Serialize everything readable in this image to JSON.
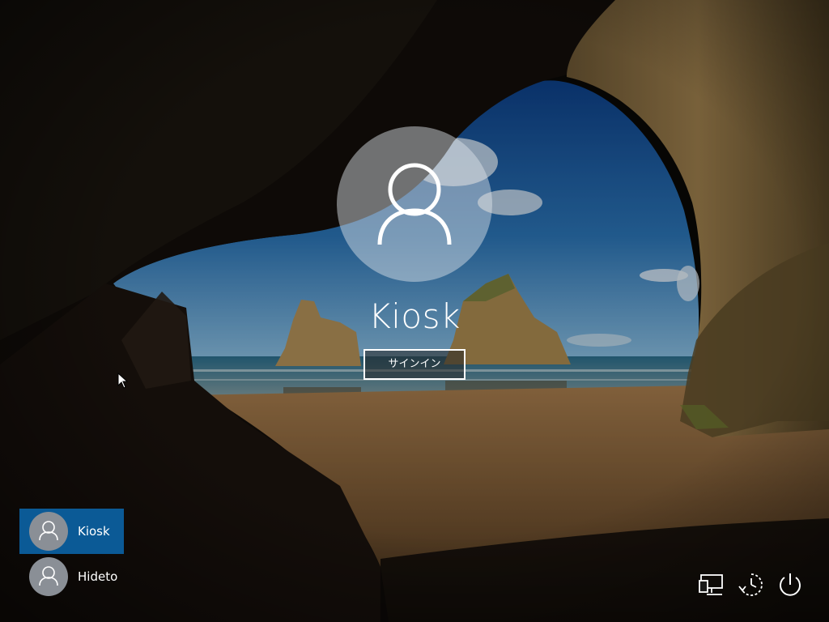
{
  "lock_screen": {
    "background": "cave-beach-wallpaper",
    "avatar_icon": "user-icon",
    "username": "Kiosk",
    "signin_label": "サインイン"
  },
  "users": [
    {
      "name": "Kiosk",
      "selected": true
    },
    {
      "name": "Hideto",
      "selected": false
    }
  ],
  "system_tray": {
    "icons": [
      "network-icon",
      "ease-of-access-icon",
      "power-icon"
    ]
  },
  "colors": {
    "selected_user_bg": "#0b5a96",
    "avatar_bg": "#8a8f96"
  }
}
